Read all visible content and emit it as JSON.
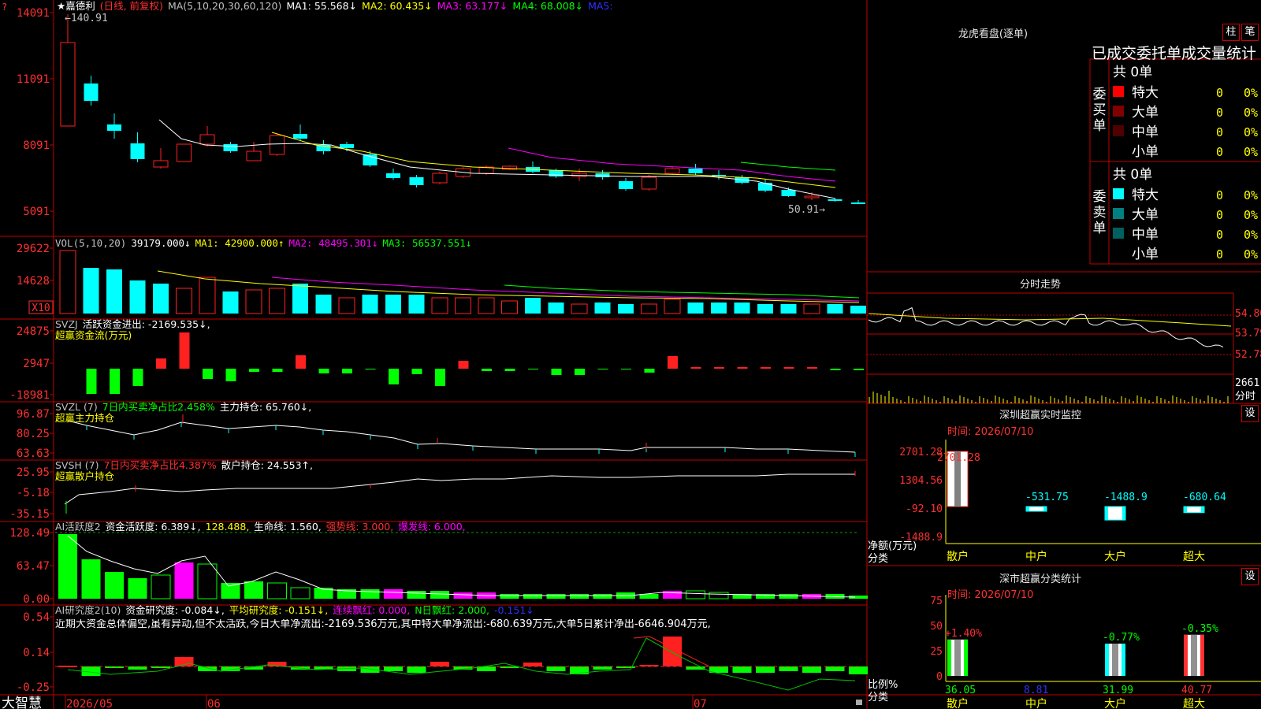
{
  "colors": {
    "up": "#ff2020",
    "down": "#00ffff",
    "green": "#00ff00",
    "grid": "#c00000",
    "ma1": "#ffffff",
    "ma2": "#ffff00",
    "ma3": "#ff00ff",
    "ma4": "#00ff00",
    "ma5": "#0000ff"
  },
  "kline": {
    "title": "嘉德利",
    "period": "(日线, 前复权)",
    "ma_label": "MA(5,10,20,30,60,120)",
    "ma1": "MA1: 55.568↓",
    "ma2": "MA2: 60.435↓",
    "ma3": "MA3: 63.177↓",
    "ma4": "MA4: 68.008↓",
    "ma5": "MA5:",
    "y_labels": [
      "14091",
      "11091",
      "8091",
      "5091"
    ],
    "high_label": "←140.91",
    "low_label": "50.91→"
  },
  "vol": {
    "label": "VOL(5,10,20)",
    "v": "39179.000↓",
    "ma1": "MA1: 42900.000↑",
    "ma2": "MA2: 48495.301↓",
    "ma3": "MA3: 56537.551↓",
    "y_labels": [
      "29622",
      "14628"
    ],
    "unit": "X10"
  },
  "svzj": {
    "label": "SVZJ",
    "desc": "活跃资金进出: -2169.535↓,",
    "sub": "超赢资金流(万元)",
    "y_labels": [
      "24875",
      "2947",
      "-18981"
    ]
  },
  "svzl": {
    "label": "SVZL (7)",
    "desc": "7日内买卖净占比2.458%",
    "pos": "主力持仓: 65.760↓,",
    "sub": "超赢主力持仓",
    "y_labels": [
      "96.87",
      "80.25",
      "63.63"
    ]
  },
  "svsh": {
    "label": "SVSH (7)",
    "desc": "7日内买卖净占比4.387%",
    "pos": "散户持仓: 24.553↑,",
    "sub": "超赢散户持仓",
    "y_labels": [
      "25.95",
      "-5.18",
      "-35.15"
    ]
  },
  "ai1": {
    "label": "AI活跃度2",
    "a": "资金活跃度: 6.389↓,",
    "b": "128.488,",
    "c": "生命线: 1.560,",
    "d": "强势线: 3.000,",
    "e": "爆发线: 6.000,",
    "y_labels": [
      "128.49",
      "63.47",
      "0.00"
    ]
  },
  "ai2": {
    "label": "AI研究度2(10)",
    "a": "资金研究度: -0.084↓,",
    "b": "平均研究度: -0.151↓,",
    "c": "连续飘红: 0.000,",
    "d": "N日飘红: 2.000,",
    "e": "-0.151↓",
    "note": "近期大资金总体偏空,虽有异动,但不太活跃,今日大单净流出:-2169.536万元,其中特大单净流出:-680.639万元,大单5日累计净出-6646.904万元,",
    "y_labels": [
      "0.54",
      "0.14",
      "-0.25"
    ]
  },
  "xaxis": {
    "brand": "大智慧",
    "labels": [
      "2026/05",
      "06",
      "07"
    ]
  },
  "lhb": {
    "title": "龙虎看盘(逐单)",
    "btn1": "柱",
    "btn2": "笔",
    "header": "已成交委托单成交量统计",
    "buy": {
      "side": "委买单",
      "total": "共 0单",
      "rows": [
        {
          "name": "特大",
          "v": "0",
          "p": "0%",
          "color": "#ff0000"
        },
        {
          "name": "大单",
          "v": "0",
          "p": "0%",
          "color": "#800000"
        },
        {
          "name": "中单",
          "v": "0",
          "p": "0%",
          "color": "#500000"
        },
        {
          "name": "小单",
          "v": "0",
          "p": "0%",
          "color": "#000000"
        }
      ]
    },
    "sell": {
      "side": "委卖单",
      "total": "共 0单",
      "rows": [
        {
          "name": "特大",
          "v": "0",
          "p": "0%",
          "color": "#00ffff"
        },
        {
          "name": "大单",
          "v": "0",
          "p": "0%",
          "color": "#008080"
        },
        {
          "name": "中单",
          "v": "0",
          "p": "0%",
          "color": "#006060"
        },
        {
          "name": "小单",
          "v": "0",
          "p": "0%",
          "color": "#000000"
        }
      ]
    }
  },
  "fenshi": {
    "title": "分时走势",
    "y_labels": [
      "54.80",
      "53.79",
      "52.78"
    ],
    "vol_label": "2661",
    "unit": "分时"
  },
  "monitor": {
    "title": "深圳超赢实时监控",
    "btn": "设",
    "time": "时间: 2026/07/10",
    "ylabel": "净额(万元)",
    "xlabel": "分类",
    "y_labels": [
      "2701.28",
      "1304.56",
      "-92.10",
      "-1488.9"
    ],
    "chart_data": {
      "type": "bar",
      "categories": [
        "散户",
        "中户",
        "大户",
        "超大"
      ],
      "values": [
        2701.28,
        -531.75,
        -1488.9,
        -680.64
      ],
      "ylim": [
        -1488.9,
        2701.28
      ]
    },
    "value_labels": [
      "2701.28",
      "-531.75",
      "-1488.9",
      "-680.64"
    ]
  },
  "classify": {
    "title": "深市超赢分类统计",
    "btn": "设",
    "time": "时间: 2026/07/10",
    "ylabel": "比例%",
    "xlabel": "分类",
    "y_labels": [
      "75",
      "50",
      "25",
      "0"
    ],
    "chart_data": {
      "type": "bar",
      "categories": [
        "散户",
        "中户",
        "大户",
        "超大"
      ],
      "values": [
        36.05,
        8.81,
        31.99,
        40.77
      ],
      "changes": [
        "+1.40%",
        "",
        "-0.77%",
        "-0.35%"
      ],
      "ylim": [
        0,
        75
      ]
    },
    "value_labels": [
      "36.05",
      "8.81",
      "31.99",
      "40.77"
    ]
  }
}
